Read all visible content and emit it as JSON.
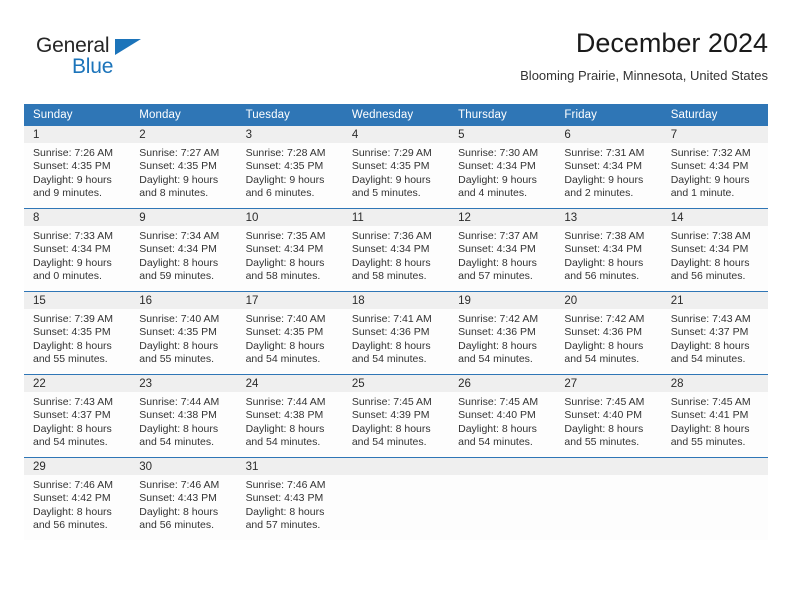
{
  "brand": {
    "name_part1": "General",
    "name_part2": "Blue",
    "logo_icon": "triangle-icon",
    "color_primary": "#1c74ba",
    "color_text": "#262626"
  },
  "header": {
    "month_title": "December 2024",
    "location": "Blooming Prairie, Minnesota, United States"
  },
  "calendar": {
    "header_bg": "#2f76b6",
    "header_text_color": "#ffffff",
    "daynum_bg": "#efefef",
    "cell_bg": "#fdfdfd",
    "separator_color": "#2f76b6",
    "weekday_headers": [
      "Sunday",
      "Monday",
      "Tuesday",
      "Wednesday",
      "Thursday",
      "Friday",
      "Saturday"
    ],
    "weeks": [
      [
        {
          "day": "1",
          "sunrise": "Sunrise: 7:26 AM",
          "sunset": "Sunset: 4:35 PM",
          "daylight_l1": "Daylight: 9 hours",
          "daylight_l2": "and 9 minutes."
        },
        {
          "day": "2",
          "sunrise": "Sunrise: 7:27 AM",
          "sunset": "Sunset: 4:35 PM",
          "daylight_l1": "Daylight: 9 hours",
          "daylight_l2": "and 8 minutes."
        },
        {
          "day": "3",
          "sunrise": "Sunrise: 7:28 AM",
          "sunset": "Sunset: 4:35 PM",
          "daylight_l1": "Daylight: 9 hours",
          "daylight_l2": "and 6 minutes."
        },
        {
          "day": "4",
          "sunrise": "Sunrise: 7:29 AM",
          "sunset": "Sunset: 4:35 PM",
          "daylight_l1": "Daylight: 9 hours",
          "daylight_l2": "and 5 minutes."
        },
        {
          "day": "5",
          "sunrise": "Sunrise: 7:30 AM",
          "sunset": "Sunset: 4:34 PM",
          "daylight_l1": "Daylight: 9 hours",
          "daylight_l2": "and 4 minutes."
        },
        {
          "day": "6",
          "sunrise": "Sunrise: 7:31 AM",
          "sunset": "Sunset: 4:34 PM",
          "daylight_l1": "Daylight: 9 hours",
          "daylight_l2": "and 2 minutes."
        },
        {
          "day": "7",
          "sunrise": "Sunrise: 7:32 AM",
          "sunset": "Sunset: 4:34 PM",
          "daylight_l1": "Daylight: 9 hours",
          "daylight_l2": "and 1 minute."
        }
      ],
      [
        {
          "day": "8",
          "sunrise": "Sunrise: 7:33 AM",
          "sunset": "Sunset: 4:34 PM",
          "daylight_l1": "Daylight: 9 hours",
          "daylight_l2": "and 0 minutes."
        },
        {
          "day": "9",
          "sunrise": "Sunrise: 7:34 AM",
          "sunset": "Sunset: 4:34 PM",
          "daylight_l1": "Daylight: 8 hours",
          "daylight_l2": "and 59 minutes."
        },
        {
          "day": "10",
          "sunrise": "Sunrise: 7:35 AM",
          "sunset": "Sunset: 4:34 PM",
          "daylight_l1": "Daylight: 8 hours",
          "daylight_l2": "and 58 minutes."
        },
        {
          "day": "11",
          "sunrise": "Sunrise: 7:36 AM",
          "sunset": "Sunset: 4:34 PM",
          "daylight_l1": "Daylight: 8 hours",
          "daylight_l2": "and 58 minutes."
        },
        {
          "day": "12",
          "sunrise": "Sunrise: 7:37 AM",
          "sunset": "Sunset: 4:34 PM",
          "daylight_l1": "Daylight: 8 hours",
          "daylight_l2": "and 57 minutes."
        },
        {
          "day": "13",
          "sunrise": "Sunrise: 7:38 AM",
          "sunset": "Sunset: 4:34 PM",
          "daylight_l1": "Daylight: 8 hours",
          "daylight_l2": "and 56 minutes."
        },
        {
          "day": "14",
          "sunrise": "Sunrise: 7:38 AM",
          "sunset": "Sunset: 4:34 PM",
          "daylight_l1": "Daylight: 8 hours",
          "daylight_l2": "and 56 minutes."
        }
      ],
      [
        {
          "day": "15",
          "sunrise": "Sunrise: 7:39 AM",
          "sunset": "Sunset: 4:35 PM",
          "daylight_l1": "Daylight: 8 hours",
          "daylight_l2": "and 55 minutes."
        },
        {
          "day": "16",
          "sunrise": "Sunrise: 7:40 AM",
          "sunset": "Sunset: 4:35 PM",
          "daylight_l1": "Daylight: 8 hours",
          "daylight_l2": "and 55 minutes."
        },
        {
          "day": "17",
          "sunrise": "Sunrise: 7:40 AM",
          "sunset": "Sunset: 4:35 PM",
          "daylight_l1": "Daylight: 8 hours",
          "daylight_l2": "and 54 minutes."
        },
        {
          "day": "18",
          "sunrise": "Sunrise: 7:41 AM",
          "sunset": "Sunset: 4:36 PM",
          "daylight_l1": "Daylight: 8 hours",
          "daylight_l2": "and 54 minutes."
        },
        {
          "day": "19",
          "sunrise": "Sunrise: 7:42 AM",
          "sunset": "Sunset: 4:36 PM",
          "daylight_l1": "Daylight: 8 hours",
          "daylight_l2": "and 54 minutes."
        },
        {
          "day": "20",
          "sunrise": "Sunrise: 7:42 AM",
          "sunset": "Sunset: 4:36 PM",
          "daylight_l1": "Daylight: 8 hours",
          "daylight_l2": "and 54 minutes."
        },
        {
          "day": "21",
          "sunrise": "Sunrise: 7:43 AM",
          "sunset": "Sunset: 4:37 PM",
          "daylight_l1": "Daylight: 8 hours",
          "daylight_l2": "and 54 minutes."
        }
      ],
      [
        {
          "day": "22",
          "sunrise": "Sunrise: 7:43 AM",
          "sunset": "Sunset: 4:37 PM",
          "daylight_l1": "Daylight: 8 hours",
          "daylight_l2": "and 54 minutes."
        },
        {
          "day": "23",
          "sunrise": "Sunrise: 7:44 AM",
          "sunset": "Sunset: 4:38 PM",
          "daylight_l1": "Daylight: 8 hours",
          "daylight_l2": "and 54 minutes."
        },
        {
          "day": "24",
          "sunrise": "Sunrise: 7:44 AM",
          "sunset": "Sunset: 4:38 PM",
          "daylight_l1": "Daylight: 8 hours",
          "daylight_l2": "and 54 minutes."
        },
        {
          "day": "25",
          "sunrise": "Sunrise: 7:45 AM",
          "sunset": "Sunset: 4:39 PM",
          "daylight_l1": "Daylight: 8 hours",
          "daylight_l2": "and 54 minutes."
        },
        {
          "day": "26",
          "sunrise": "Sunrise: 7:45 AM",
          "sunset": "Sunset: 4:40 PM",
          "daylight_l1": "Daylight: 8 hours",
          "daylight_l2": "and 54 minutes."
        },
        {
          "day": "27",
          "sunrise": "Sunrise: 7:45 AM",
          "sunset": "Sunset: 4:40 PM",
          "daylight_l1": "Daylight: 8 hours",
          "daylight_l2": "and 55 minutes."
        },
        {
          "day": "28",
          "sunrise": "Sunrise: 7:45 AM",
          "sunset": "Sunset: 4:41 PM",
          "daylight_l1": "Daylight: 8 hours",
          "daylight_l2": "and 55 minutes."
        }
      ],
      [
        {
          "day": "29",
          "sunrise": "Sunrise: 7:46 AM",
          "sunset": "Sunset: 4:42 PM",
          "daylight_l1": "Daylight: 8 hours",
          "daylight_l2": "and 56 minutes."
        },
        {
          "day": "30",
          "sunrise": "Sunrise: 7:46 AM",
          "sunset": "Sunset: 4:43 PM",
          "daylight_l1": "Daylight: 8 hours",
          "daylight_l2": "and 56 minutes."
        },
        {
          "day": "31",
          "sunrise": "Sunrise: 7:46 AM",
          "sunset": "Sunset: 4:43 PM",
          "daylight_l1": "Daylight: 8 hours",
          "daylight_l2": "and 57 minutes."
        },
        {
          "day": "",
          "sunrise": "",
          "sunset": "",
          "daylight_l1": "",
          "daylight_l2": ""
        },
        {
          "day": "",
          "sunrise": "",
          "sunset": "",
          "daylight_l1": "",
          "daylight_l2": ""
        },
        {
          "day": "",
          "sunrise": "",
          "sunset": "",
          "daylight_l1": "",
          "daylight_l2": ""
        },
        {
          "day": "",
          "sunrise": "",
          "sunset": "",
          "daylight_l1": "",
          "daylight_l2": ""
        }
      ]
    ]
  }
}
